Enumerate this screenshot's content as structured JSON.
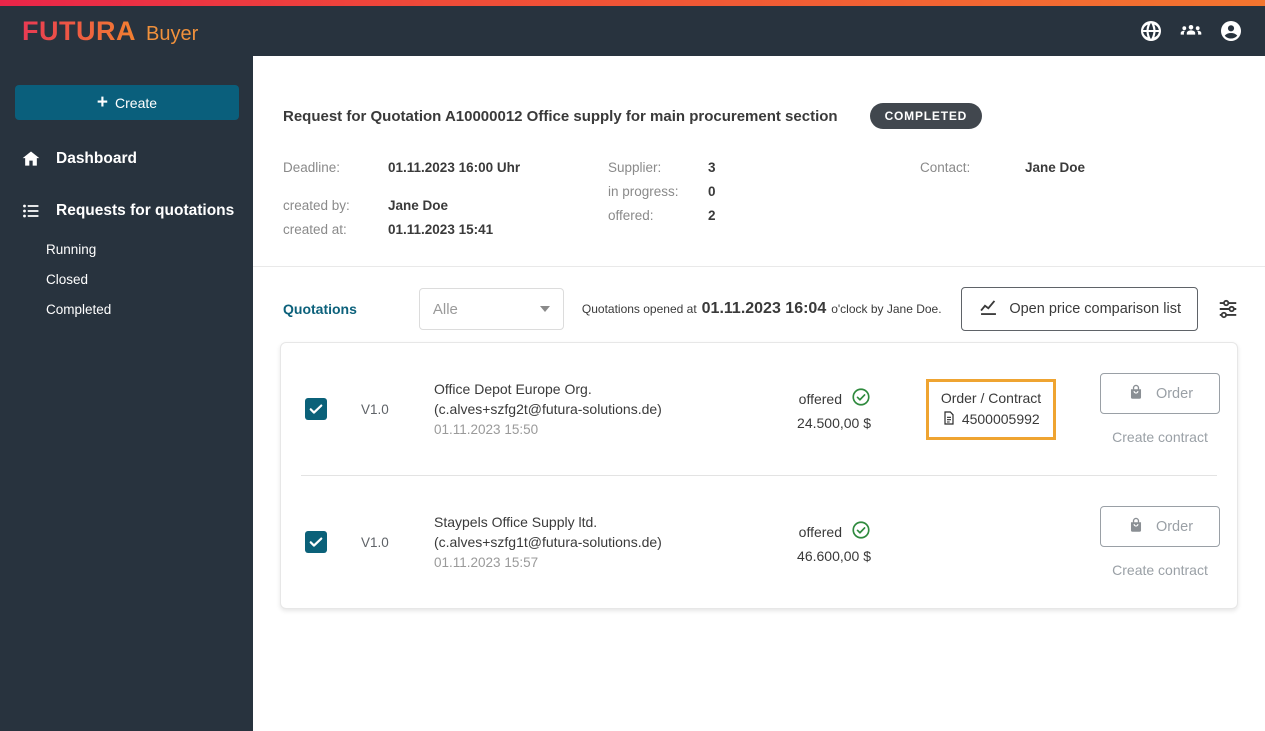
{
  "brand": {
    "logo": "FUTURA",
    "product": "Buyer"
  },
  "header": {
    "icons": [
      "globe",
      "members",
      "account"
    ]
  },
  "sidebar": {
    "create": {
      "plus": "+",
      "label": "Create"
    },
    "nav": [
      {
        "label": "Dashboard"
      },
      {
        "label": "Requests for quotations"
      }
    ],
    "sub": [
      {
        "label": "Running"
      },
      {
        "label": "Closed"
      },
      {
        "label": "Completed"
      }
    ]
  },
  "request": {
    "title": "Request for Quotation A10000012 Office supply for main procurement section",
    "status_badge": "COMPLETED",
    "deadline_label": "Deadline:",
    "deadline_value": "01.11.2023 16:00 Uhr",
    "created_by_label": "created by:",
    "created_by_value": "Jane Doe",
    "created_at_label": "created at:",
    "created_at_value": "01.11.2023 15:41",
    "supplier_label": "Supplier:",
    "supplier_value": "3",
    "in_progress_label": "in progress:",
    "in_progress_value": "0",
    "offered_label": "offered:",
    "offered_value": "2",
    "contact_label": "Contact:",
    "contact_value": "Jane Doe"
  },
  "quotations": {
    "section_label": "Quotations",
    "filter_value": "Alle",
    "opened_prefix": "Quotations opened at",
    "opened_time": "01.11.2023 16:04",
    "opened_suffix": "o'clock by Jane Doe.",
    "compare_button_label": "Open price comparison list",
    "rows": [
      {
        "version": "V1.0",
        "name": "Office Depot Europe Org.",
        "email": "(c.alves+szfg2t@futura-solutions.de)",
        "date": "01.11.2023 15:50",
        "status": "offered",
        "amount": "24.500,00 $",
        "contract_label": "Order / Contract",
        "contract_number": "4500005992",
        "order_button": "Order",
        "create_contract": "Create contract"
      },
      {
        "version": "V1.0",
        "name": "Staypels Office Supply ltd.",
        "email": "(c.alves+szfg1t@futura-solutions.de)",
        "date": "01.11.2023 15:57",
        "status": "offered",
        "amount": "46.600,00 $",
        "order_button": "Order",
        "create_contract": "Create contract"
      }
    ]
  }
}
